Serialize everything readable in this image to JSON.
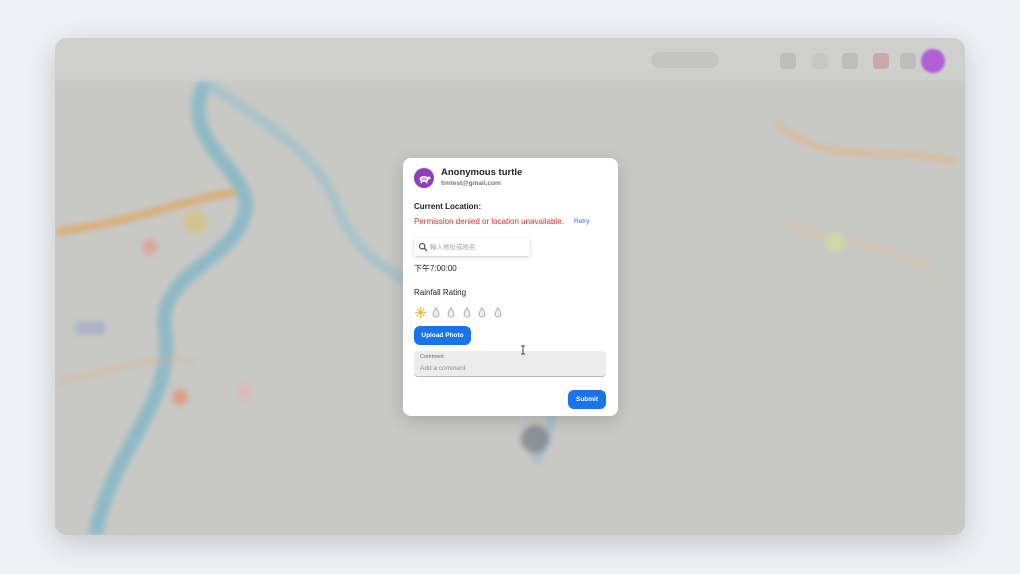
{
  "user": {
    "name": "Anonymous turtle",
    "email": "timtest@gmail.com",
    "avatar_icon": "turtle-icon",
    "avatar_color": "#8e3fb8"
  },
  "location": {
    "title": "Current Location:",
    "error": "Permission denied or location unavailable.",
    "retry_label": "Retry",
    "error_color": "#d0342c"
  },
  "search": {
    "placeholder": "輸入地址或地名",
    "value": "",
    "icon": "search-icon"
  },
  "time": "下午7:00:00",
  "rainfall": {
    "label": "Rainfall Rating",
    "levels": [
      "sun-icon",
      "raindrop-icon",
      "raindrop-icon",
      "raindrop-icon",
      "raindrop-icon",
      "raindrop-icon"
    ],
    "selected": 0
  },
  "actions": {
    "upload_label": "Upload Photo",
    "submit_label": "Submit",
    "accent": "#1a73e8"
  },
  "comment": {
    "label": "Comment",
    "placeholder": "Add a comment",
    "value": ""
  }
}
